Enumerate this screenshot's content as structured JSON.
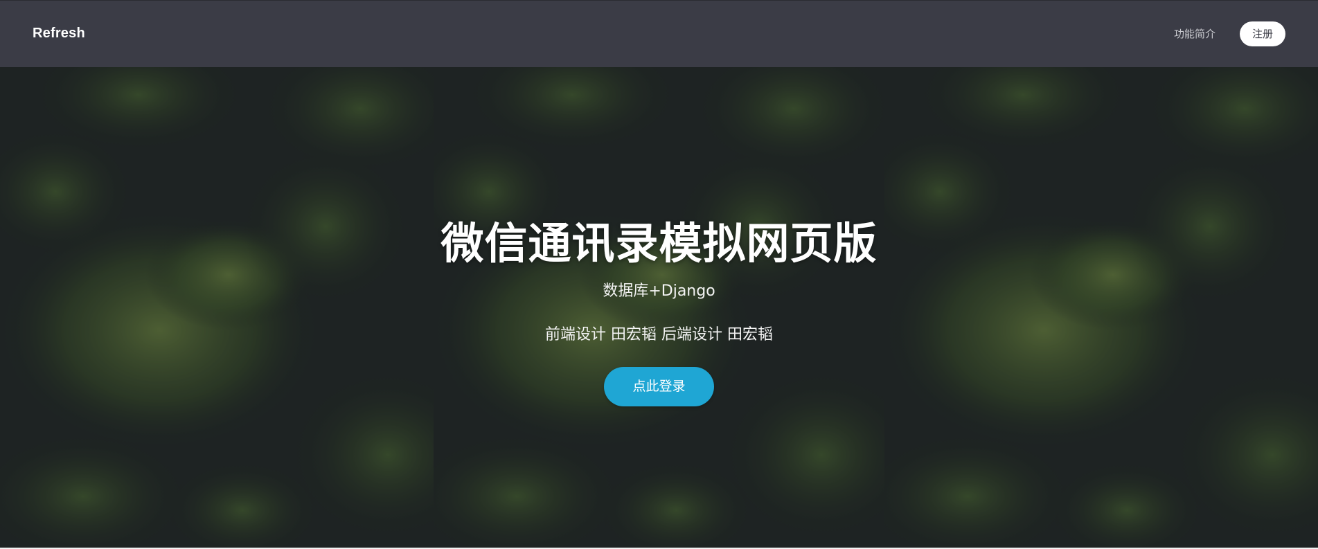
{
  "header": {
    "brand": "Refresh",
    "nav_features": "功能简介",
    "nav_signup": "注册"
  },
  "hero": {
    "title": "微信通讯录模拟网页版",
    "subtitle": "数据库+Django",
    "credits": "前端设计 田宏韬 后端设计 田宏韬",
    "login_button": "点此登录"
  },
  "colors": {
    "header_bg": "#3b3c46",
    "accent": "#1fa6d4",
    "text": "#ffffff"
  }
}
